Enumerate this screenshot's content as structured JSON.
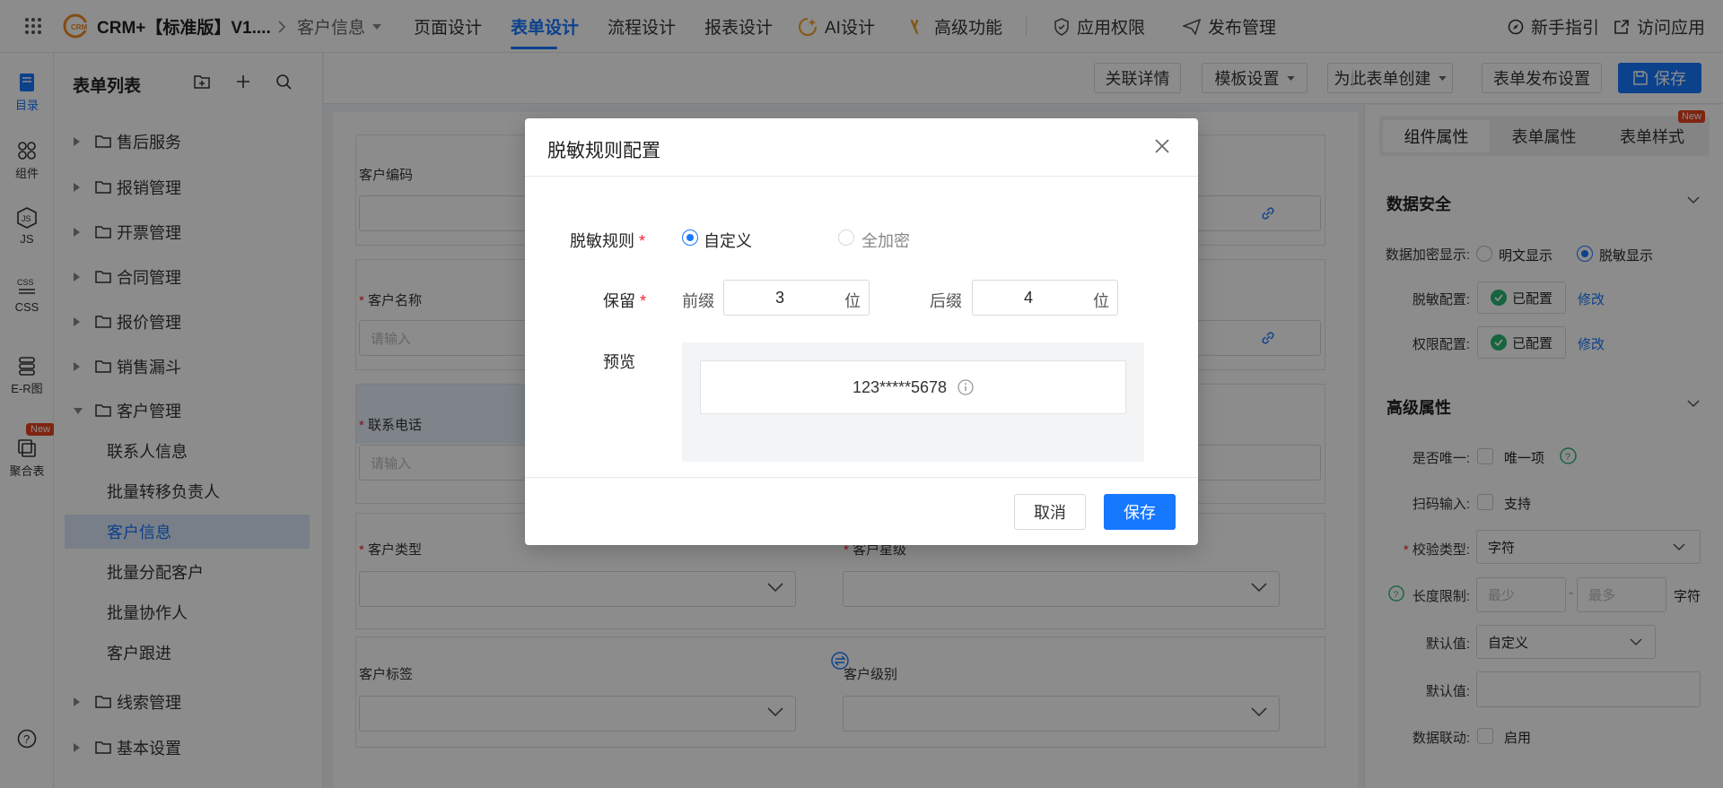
{
  "topbar": {
    "app_name": "CRM+【标准版】V1....",
    "breadcrumb_form": "客户信息",
    "nav": [
      "页面设计",
      "表单设计",
      "流程设计",
      "报表设计",
      "AI设计",
      "高级功能",
      "应用权限",
      "发布管理"
    ],
    "right": [
      "新手指引",
      "访问应用"
    ]
  },
  "rail": {
    "items": [
      "目录",
      "组件",
      "JS",
      "CSS",
      "E-R图",
      "聚合表"
    ],
    "new_badge": "New"
  },
  "sidebar": {
    "title": "表单列表",
    "folders_top": [
      "售后服务",
      "报销管理",
      "开票管理",
      "合同管理",
      "报价管理",
      "销售漏斗",
      "客户管理"
    ],
    "children": [
      "联系人信息",
      "批量转移负责人",
      "客户信息",
      "批量分配客户",
      "批量协作人",
      "客户跟进"
    ],
    "folders_bottom": [
      "线索管理",
      "基本设置"
    ]
  },
  "toolbar": {
    "related": "关联详情",
    "template": "模板设置",
    "create_for": "为此表单创建",
    "publish_settings": "表单发布设置",
    "save": "保存"
  },
  "form": {
    "fields": {
      "code": "客户编码",
      "name": "客户名称",
      "phone": "联系电话",
      "type": "客户类型",
      "star": "客户星级",
      "tags": "客户标签",
      "level": "客户级别"
    },
    "placeholder": "请输入"
  },
  "right": {
    "tabs": [
      "组件属性",
      "表单属性",
      "表单样式"
    ],
    "new_badge": "New",
    "security": {
      "title": "数据安全",
      "encrypt_label": "数据加密显示:",
      "opt_plain": "明文显示",
      "opt_mask": "脱敏显示",
      "mask_label": "脱敏配置:",
      "perm_label": "权限配置:",
      "configured": "已配置",
      "modify": "修改"
    },
    "advanced": {
      "title": "高级属性",
      "unique_label": "是否唯一:",
      "unique_opt": "唯一项",
      "scan_label": "扫码输入:",
      "scan_opt": "支持",
      "validate_label": "校验类型:",
      "validate_value": "字符",
      "length_label": "长度限制:",
      "min_ph": "最少",
      "max_ph": "最多",
      "length_unit": "字符",
      "default_label": "默认值:",
      "default_type": "自定义",
      "default2_label": "默认值:",
      "linkage_label": "数据联动:",
      "linkage_opt": "启用"
    }
  },
  "modal": {
    "title": "脱敏规则配置",
    "rule_label": "脱敏规则",
    "opt_custom": "自定义",
    "opt_full": "全加密",
    "keep_label": "保留",
    "prefix_label": "前缀",
    "prefix_value": "3",
    "suffix_label": "后缀",
    "suffix_value": "4",
    "unit": "位",
    "preview_label": "预览",
    "preview_value": "123*****5678",
    "cancel": "取消",
    "save": "保存"
  }
}
